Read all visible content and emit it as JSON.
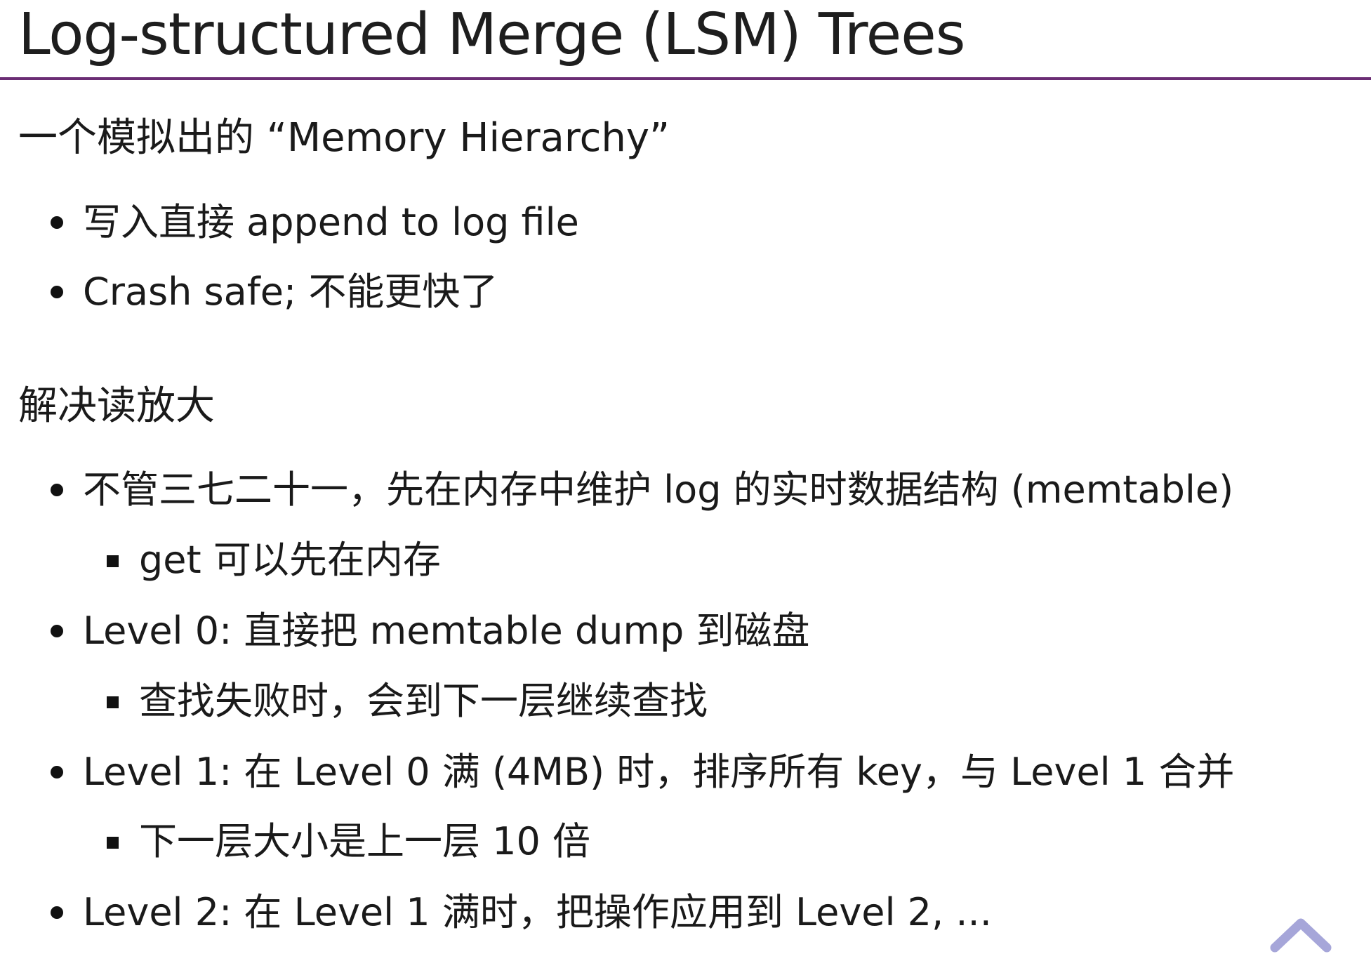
{
  "title": "Log-structured Merge (LSM) Trees",
  "sections": [
    {
      "heading": "一个模拟出的 “Memory Hierarchy”",
      "items": [
        {
          "text": "写入直接 append to log file"
        },
        {
          "text": "Crash safe; 不能更快了"
        }
      ]
    },
    {
      "heading": "解决读放大",
      "items": [
        {
          "text": "不管三七二十一，先在内存中维护 log 的实时数据结构 (memtable)",
          "sub": "get 可以先在内存"
        },
        {
          "text": "Level 0: 直接把 memtable dump 到磁盘",
          "sub": "查找失败时，会到下一层继续查找"
        },
        {
          "text": "Level 1: 在 Level 0 满 (4MB) 时，排序所有 key，与 Level 1 合并",
          "sub": "下一层大小是上一层 10 倍"
        },
        {
          "text": "Level 2: 在 Level 1 满时，把操作应用到 Level 2, ..."
        }
      ]
    }
  ],
  "nav": {
    "icon": "chevron-up-icon",
    "color": "#a6a6d9"
  },
  "colors": {
    "title_rule": "#6b2d74",
    "text": "#1a1a1a"
  }
}
